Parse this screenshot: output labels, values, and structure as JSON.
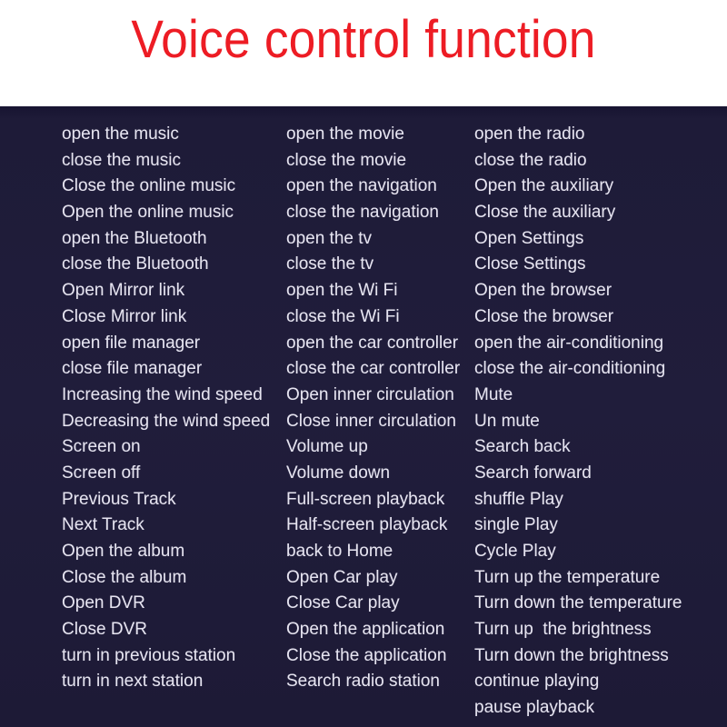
{
  "header": {
    "title": "Voice control function",
    "title_color": "#ED1C24",
    "background_color": "#FFFFFF"
  },
  "panel": {
    "background_color": "#1E1B38",
    "text_color": "#E6E4F0"
  },
  "columns": [
    {
      "name": "column-1",
      "commands": [
        "open the music",
        "close the music",
        "Close the online music",
        "Open the online music",
        "open the Bluetooth",
        "close the Bluetooth",
        "Open Mirror link",
        "Close Mirror link",
        "open file manager",
        "close file manager",
        "Increasing the wind speed",
        "Decreasing the wind speed",
        "Screen on",
        "Screen off",
        "Previous Track",
        "Next Track",
        "Open the album",
        "Close the album",
        "Open DVR",
        "Close DVR",
        "turn in previous station",
        "turn in next station"
      ]
    },
    {
      "name": "column-2",
      "commands": [
        "open the movie",
        "close the movie",
        "open the navigation",
        "close the navigation",
        "open the tv",
        "close the tv",
        "open the Wi Fi",
        "close the Wi Fi",
        "open the car controller",
        "close the car controller",
        "Open inner circulation",
        "Close inner circulation",
        "Volume up",
        "Volume down",
        "Full-screen playback",
        "Half-screen playback",
        "back to Home",
        "Open Car play",
        "Close Car play",
        "Open the application",
        "Close the application",
        "Search radio station"
      ]
    },
    {
      "name": "column-3",
      "commands": [
        "open the radio",
        "close the radio",
        "Open the auxiliary",
        "Close the auxiliary",
        "Open Settings",
        "Close Settings",
        "Open the browser",
        "Close the browser",
        "open the air-conditioning",
        "close the air-conditioning",
        "Mute",
        "Un mute",
        "Search back",
        "Search forward",
        "shuffle Play",
        "single Play",
        "Cycle Play",
        "Turn up the temperature",
        "Turn down the temperature",
        "Turn up  the brightness",
        "Turn down the brightness",
        "continue playing",
        "pause playback"
      ]
    }
  ]
}
